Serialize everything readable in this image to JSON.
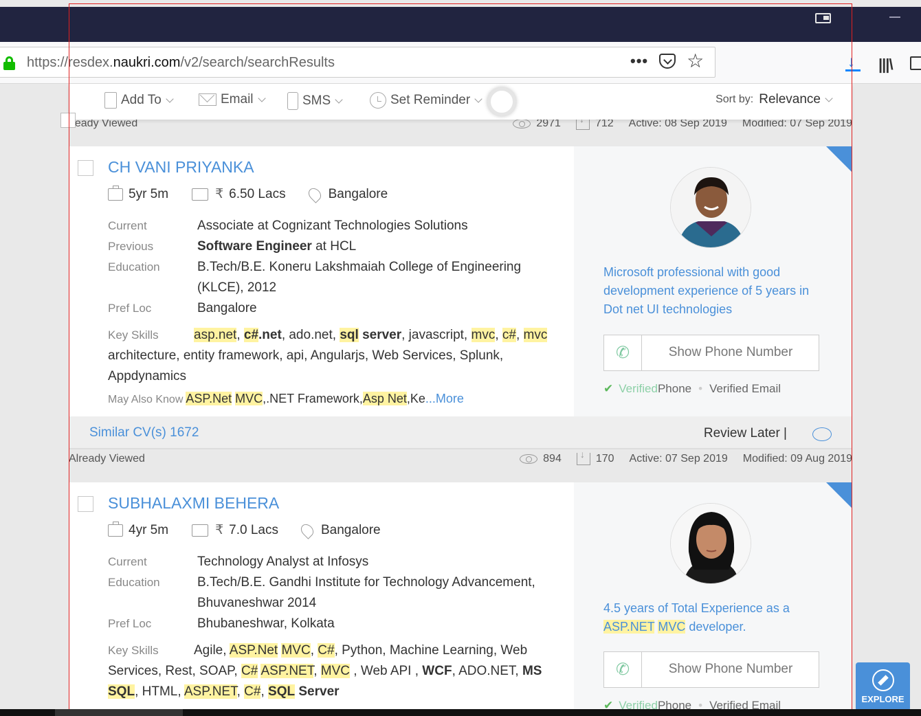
{
  "browser": {
    "url_prefix": "https://",
    "url_pre": "resdex.",
    "url_domain": "naukri.com",
    "url_path": "/v2/search/searchResults",
    "menu_dots": "•••",
    "star": "☆"
  },
  "toolbar": {
    "add_to": "Add To",
    "email": "Email",
    "sms": "SMS",
    "set_reminder": "Set Reminder",
    "sort_by": "Sort by:",
    "sort_value": "Relevance"
  },
  "results": [
    {
      "meta_left": "lready Viewed",
      "views": "2971",
      "downloads": "712",
      "active": "Active: 08 Sep 2019",
      "modified": "Modified: 07 Sep 2019",
      "name": "CH VANI PRIYANKA",
      "experience": "5yr 5m",
      "rupee": "₹",
      "salary": "6.50 Lacs",
      "location": "Bangalore",
      "labels": {
        "current": "Current",
        "previous": "Previous",
        "education": "Education",
        "pref_loc": "Pref Loc",
        "key_skills": "Key Skills",
        "may_also_know": "May Also Know"
      },
      "current": "Associate at Cognizant Technologies Solutions",
      "previous_role": "Software Engineer",
      "previous_at": " at HCL",
      "education_1": "B.Tech/B.E. Koneru Lakshmaiah College of Engineering",
      "education_2": "(KLCE), 2012",
      "pref_loc": "Bangalore",
      "summary": "Microsoft professional with good development experience of 5 years in Dot net UI technologies",
      "show_phone": "Show Phone Number",
      "verified_phone_1": "Verified",
      "verified_phone_2": " Phone",
      "verified_email": "Verified Email",
      "similar": "Similar CV(s) 1672",
      "review_later": "Review Later  |"
    },
    {
      "meta_left": "Already Viewed",
      "views": "894",
      "downloads": "170",
      "active": "Active: 07 Sep 2019",
      "modified": "Modified: 09 Aug 2019",
      "name": "SUBHALAXMI BEHERA",
      "experience": "4yr 5m",
      "rupee": "₹",
      "salary": "7.0 Lacs",
      "location": "Bangalore",
      "labels": {
        "current": "Current",
        "education": "Education",
        "pref_loc": "Pref Loc",
        "key_skills": "Key Skills"
      },
      "current": "Technology Analyst at Infosys",
      "education_1": "B.Tech/B.E. Gandhi Institute for Technology Advancement,",
      "education_2": "Bhuvaneshwar 2014",
      "pref_loc": "Bhubaneshwar, Kolkata",
      "summary_1": "4.5 years of Total Experience as a",
      "summary_hl1": "ASP.NET",
      "summary_hl2": "MVC",
      "summary_2": " developer.",
      "show_phone": "Show Phone Number",
      "verified_phone_1": "Verified",
      "verified_phone_2": " Phone",
      "verified_email": "Verified Email"
    }
  ],
  "explore": "EXPLORE"
}
